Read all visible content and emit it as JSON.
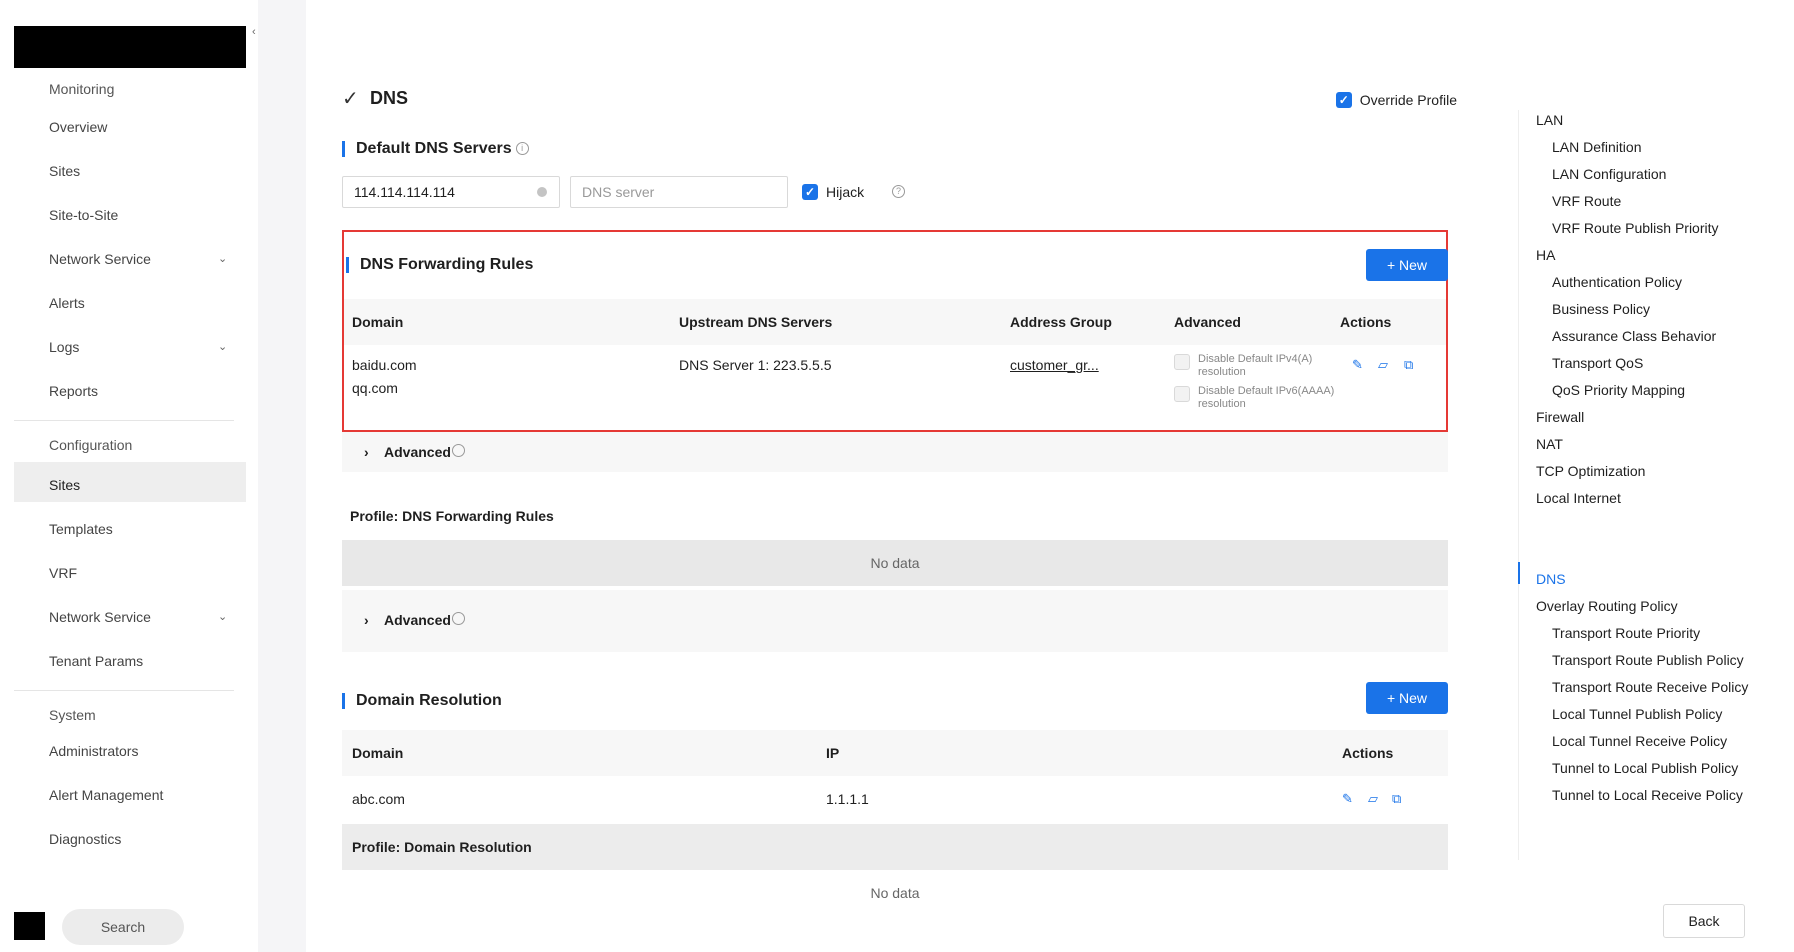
{
  "sidebar": {
    "collapse_glyph": "‹",
    "items": [
      {
        "label": "Monitoring"
      },
      {
        "label": "Overview"
      },
      {
        "label": "Sites"
      },
      {
        "label": "Site-to-Site"
      },
      {
        "label": "Network Service"
      },
      {
        "label": "Alerts"
      },
      {
        "label": "Logs"
      },
      {
        "label": "Reports"
      },
      {
        "label": "Configuration"
      },
      {
        "label": "Sites"
      },
      {
        "label": "Templates"
      },
      {
        "label": "VRF"
      },
      {
        "label": "Network Service"
      },
      {
        "label": "Tenant Params"
      },
      {
        "label": "System"
      },
      {
        "label": "Administrators"
      },
      {
        "label": "Alert Management"
      },
      {
        "label": "Diagnostics"
      }
    ],
    "chevron": "⌄",
    "search_label": "Search"
  },
  "dns": {
    "title": "DNS",
    "title_check": "✓",
    "override_profile_label": "Override Profile",
    "override_profile_checked": true,
    "default_servers": {
      "title": "Default DNS Servers",
      "info_icon": "i",
      "primary_value": "114.114.114.114",
      "secondary_placeholder": "DNS server",
      "hijack_label": "Hijack",
      "hijack_checked": true,
      "help_icon": "?"
    },
    "forwarding": {
      "title": "DNS Forwarding Rules",
      "new_label": "+ New",
      "columns": [
        "Domain",
        "Upstream DNS Servers",
        "Address Group",
        "Advanced",
        "Actions"
      ],
      "row": {
        "domains": [
          "baidu.com",
          "qq.com"
        ],
        "upstream": "DNS Server 1: 223.5.5.5",
        "address_group": "customer_gr...",
        "advanced_options": [
          {
            "line1": "Disable Default IPv4(A)",
            "line2": "resolution",
            "checked": false
          },
          {
            "line1": "Disable Default IPv6(AAAA)",
            "line2": "resolution",
            "checked": false
          }
        ]
      },
      "advanced_toggle": "Advanced",
      "profile_title": "Profile: DNS Forwarding Rules",
      "profile_empty": "No data",
      "profile_advanced_toggle": "Advanced"
    },
    "resolution": {
      "title": "Domain Resolution",
      "new_label": "+ New",
      "columns": [
        "Domain",
        "IP",
        "Actions"
      ],
      "row": {
        "domain": "abc.com",
        "ip": "1.1.1.1"
      },
      "profile_title": "Profile: Domain Resolution",
      "profile_empty": "No data"
    }
  },
  "anchors": [
    {
      "label": "LAN"
    },
    {
      "label": "LAN Definition"
    },
    {
      "label": "LAN Configuration"
    },
    {
      "label": "VRF Route"
    },
    {
      "label": "VRF Route Publish Priority"
    },
    {
      "label": "HA"
    },
    {
      "label": "Authentication Policy"
    },
    {
      "label": "Business Policy"
    },
    {
      "label": "Assurance Class Behavior"
    },
    {
      "label": "Transport QoS"
    },
    {
      "label": "QoS Priority Mapping"
    },
    {
      "label": "Firewall"
    },
    {
      "label": "NAT"
    },
    {
      "label": "TCP Optimization"
    },
    {
      "label": "Local Internet"
    },
    {
      "label": "DNS"
    },
    {
      "label": "Overlay Routing Policy"
    },
    {
      "label": "Transport Route Priority"
    },
    {
      "label": "Transport Route Publish Policy"
    },
    {
      "label": "Transport Route Receive Policy"
    },
    {
      "label": "Local Tunnel Publish Policy"
    },
    {
      "label": "Local Tunnel Receive Policy"
    },
    {
      "label": "Tunnel to Local Publish Policy"
    },
    {
      "label": "Tunnel to Local Receive Policy"
    }
  ],
  "back_label": "Back",
  "colors": {
    "accent": "#1a73e8",
    "highlight_box": "#e53935"
  }
}
